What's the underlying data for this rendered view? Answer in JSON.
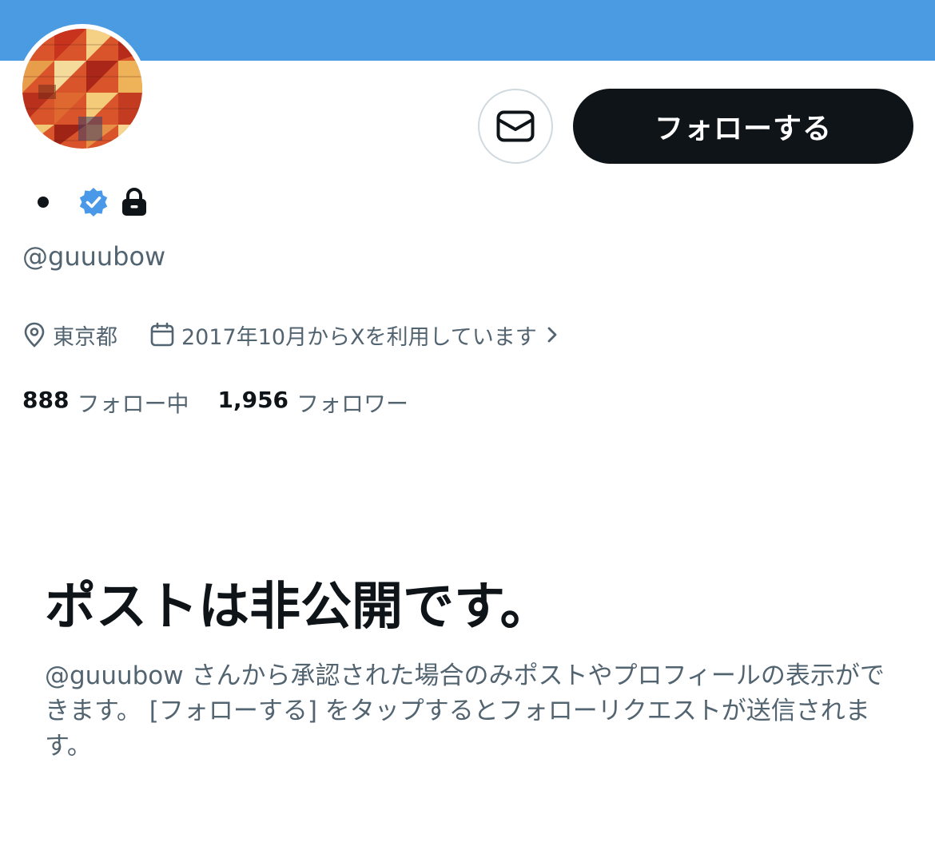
{
  "profile": {
    "display_name": "•",
    "handle": "@guuubow",
    "location": "東京都",
    "joined": "2017年10月からXを利用しています",
    "following_count": "888",
    "following_label": "フォロー中",
    "followers_count": "1,956",
    "followers_label": "フォロワー",
    "verified": true,
    "protected": true
  },
  "actions": {
    "message_icon": "envelope-icon",
    "follow_label": "フォローする"
  },
  "private_notice": {
    "title": "ポストは非公開です。",
    "description": "@guuubow さんから承認された場合のみポストやプロフィールの表示ができます。 [フォローする] をタップするとフォローリクエストが送信されます。"
  },
  "colors": {
    "banner": "#4b9be3",
    "verified": "#4a99e9",
    "button_dark": "#0f1419",
    "secondary_text": "#536471"
  }
}
